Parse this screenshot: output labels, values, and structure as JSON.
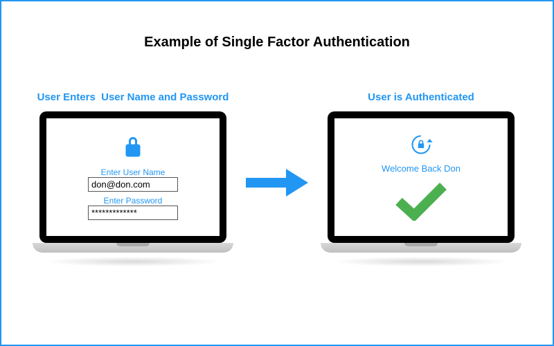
{
  "title": "Example of Single Factor Authentication",
  "left": {
    "caption": "User Enters  User Name and Password",
    "username_label": "Enter User Name",
    "username_value": "don@don.com",
    "password_label": "Enter Password",
    "password_value": "*************"
  },
  "right": {
    "caption": "User is Authenticated",
    "welcome": "Welcome Back Don"
  },
  "colors": {
    "accent": "#2196f3",
    "success": "#4caf50"
  }
}
